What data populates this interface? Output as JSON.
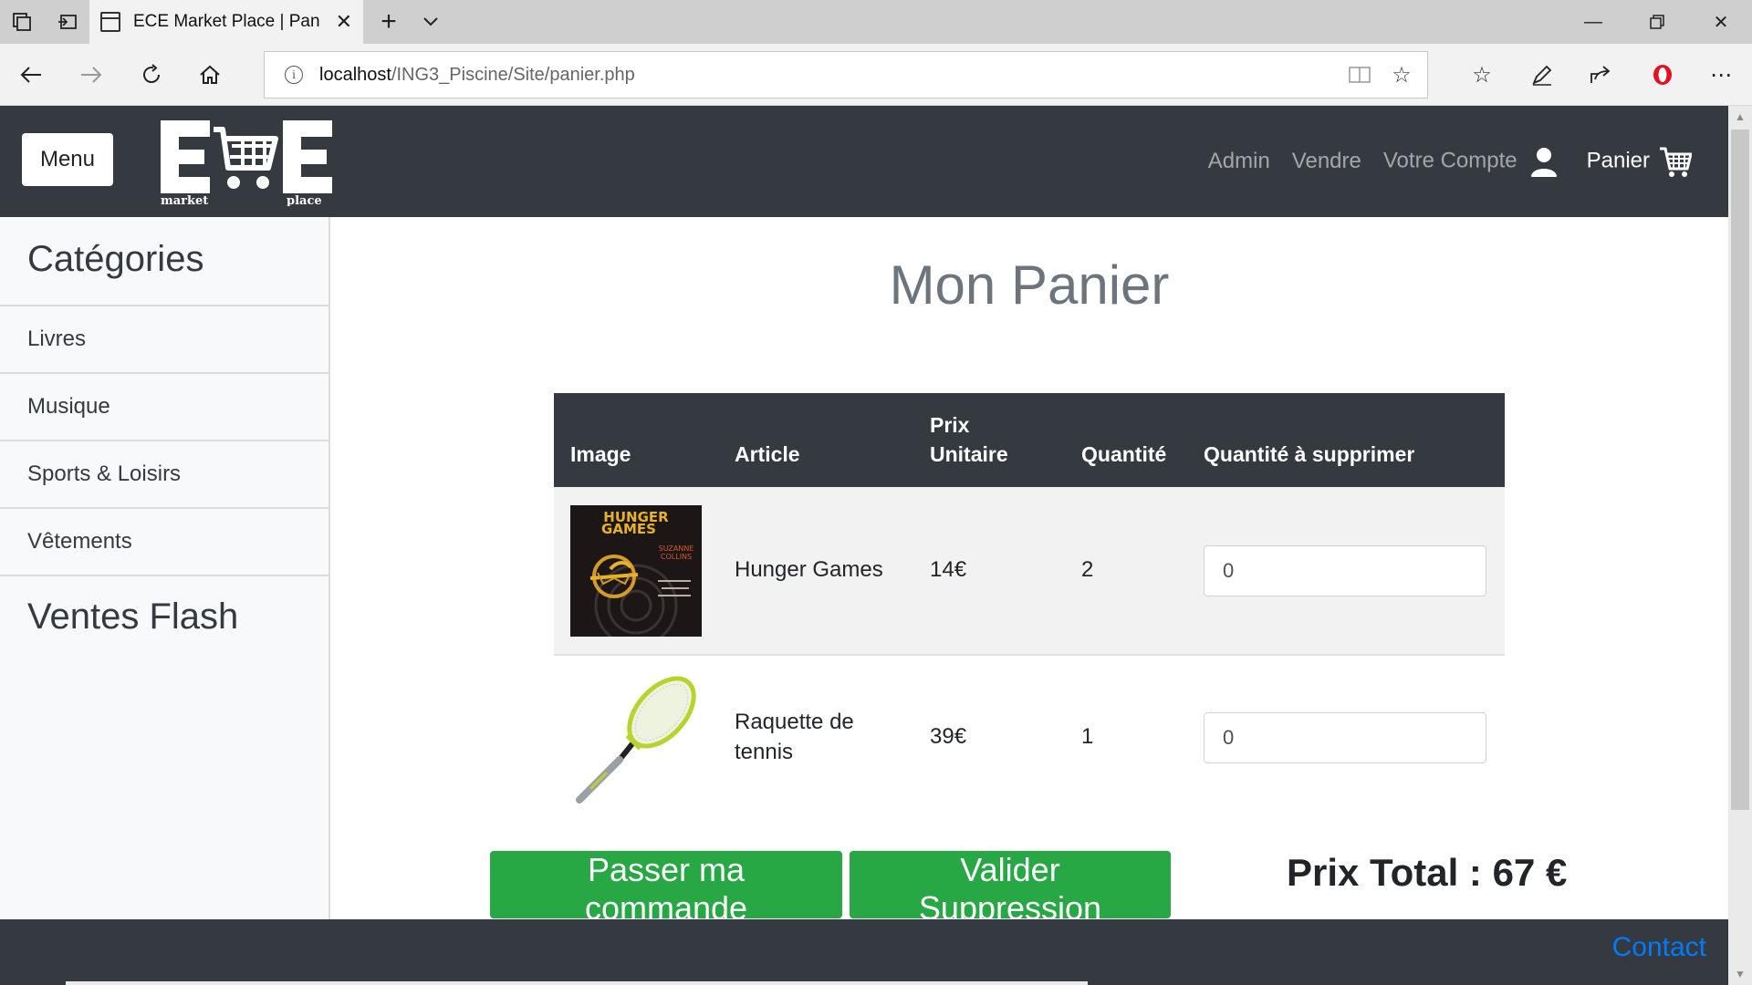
{
  "browser": {
    "tab_title": "ECE Market Place | Panier",
    "url_host": "localhost",
    "url_path": "/ING3_Piscine/Site/panier.php"
  },
  "header": {
    "menu_label": "Menu",
    "logo_text_left": "market",
    "logo_text_right": "place",
    "nav": {
      "admin": "Admin",
      "vendre": "Vendre",
      "compte": "Votre Compte",
      "panier": "Panier"
    }
  },
  "sidebar": {
    "title": "Catégories",
    "items": [
      {
        "label": "Livres"
      },
      {
        "label": "Musique"
      },
      {
        "label": "Sports & Loisirs"
      },
      {
        "label": "Vêtements"
      }
    ],
    "flash": "Ventes Flash"
  },
  "main": {
    "title": "Mon Panier",
    "columns": {
      "image": "Image",
      "article": "Article",
      "prix_line1": "Prix",
      "prix_line2": "Unitaire",
      "quantite": "Quantité",
      "supprimer": "Quantité à supprimer"
    },
    "rows": [
      {
        "article": "Hunger Games",
        "prix": "14€",
        "quantite": "2",
        "supprimer_value": "0"
      },
      {
        "article_line1": "Raquette de",
        "article_line2": "tennis",
        "prix": "39€",
        "quantite": "1",
        "supprimer_value": "0"
      }
    ],
    "book_cover": {
      "title1": "HUNGER",
      "title2": "GAMES",
      "author1": "SUZANNE",
      "author2": "COLLINS"
    },
    "buttons": {
      "commander": "Passer ma commande",
      "valider": "Valider Suppression"
    },
    "total": "Prix Total : 67 €"
  },
  "footer": {
    "contact": "Contact"
  },
  "colors": {
    "header_bg": "#343a40",
    "button_green": "#28a745",
    "link_blue": "#007bff"
  }
}
